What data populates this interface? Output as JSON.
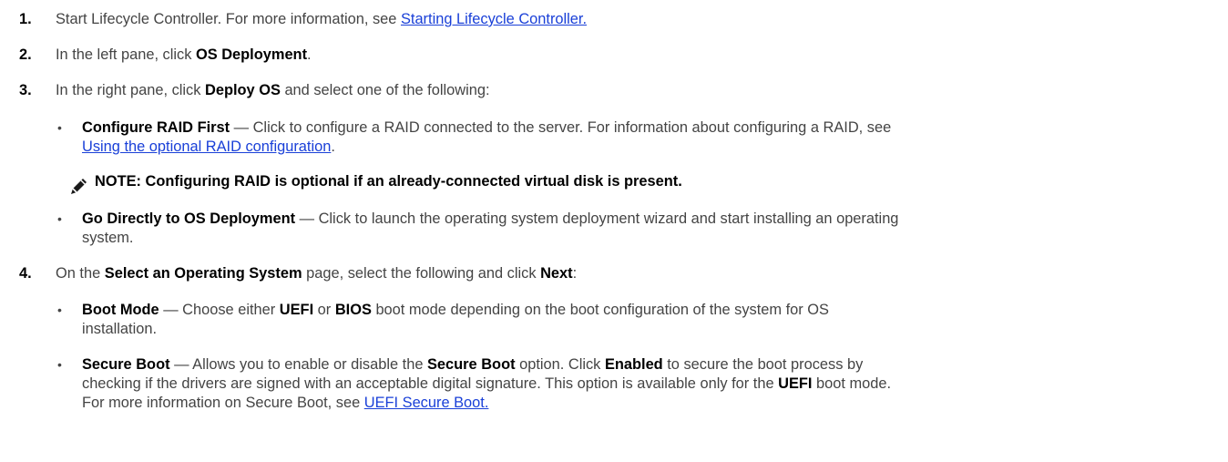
{
  "steps": {
    "s1": {
      "num": "1.",
      "text": "Start Lifecycle Controller. For more information, see ",
      "link": "Starting Lifecycle Controller."
    },
    "s2": {
      "num": "2.",
      "text": "In the left pane, click ",
      "bold": "OS Deployment",
      "end": "."
    },
    "s3": {
      "num": "3.",
      "text": "In the right pane, click ",
      "bold": "Deploy OS",
      "end": " and select one of the following:"
    },
    "s4": {
      "num": "4.",
      "text": "On the ",
      "bold1": "Select an Operating System",
      "mid": " page, select the following and click ",
      "bold2": "Next",
      "end": ":"
    }
  },
  "bullets": {
    "raid": {
      "marker": "•",
      "title": "Configure RAID First",
      "line1": " — Click to configure a RAID connected to the server. For information about configuring a RAID, see",
      "link": "Using the optional RAID configuration",
      "end": "."
    },
    "note": {
      "icon": "pencil-note-icon",
      "text": "NOTE: Configuring RAID is optional if an already-connected virtual disk is present."
    },
    "direct": {
      "marker": "•",
      "title": "Go Directly to OS Deployment",
      "line1": " — Click to launch the operating system deployment wizard and start installing an operating",
      "line2": "system."
    },
    "boot": {
      "marker": "•",
      "title": "Boot Mode",
      "a": " — Choose either ",
      "uefi": "UEFI",
      "b": " or ",
      "bios": "BIOS",
      "c": " boot mode depending on the boot configuration of the system for OS",
      "line2": "installation."
    },
    "secure": {
      "marker": "•",
      "title": "Secure Boot",
      "a": " — Allows you to enable or disable the ",
      "sb": "Secure Boot",
      "b": " option. Click ",
      "enabled": "Enabled",
      "c": " to secure the boot process by",
      "line2a": "checking if the drivers are signed with an acceptable digital signature. This option is available only for the ",
      "uefi": "UEFI",
      "line2b": " boot mode.",
      "line3": "For more information on Secure Boot, see ",
      "link": "UEFI Secure Boot."
    }
  },
  "colors": {
    "link": "#1a40d8",
    "text": "#444444"
  }
}
